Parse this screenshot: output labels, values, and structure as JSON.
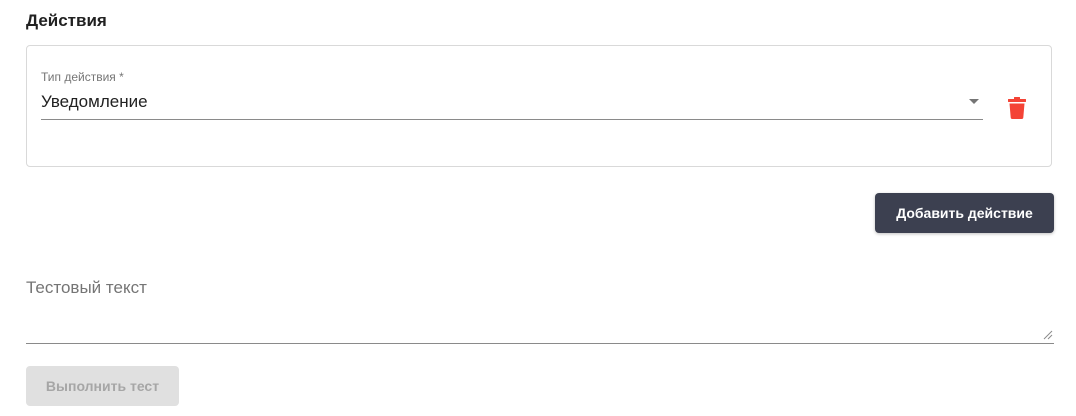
{
  "actions_section": {
    "title": "Действия",
    "items": [
      {
        "type_label": "Тип действия *",
        "type_value": "Уведомление",
        "delete_icon": "trash-icon"
      }
    ],
    "add_button_label": "Добавить действие"
  },
  "test": {
    "text_label": "Тестовый текст",
    "text_value": "",
    "run_button_label": "Выполнить тест",
    "run_button_disabled": true
  },
  "colors": {
    "primary_button": "#3c4050",
    "delete_icon": "#f44336",
    "disabled_button_bg": "#e0e0e0",
    "disabled_button_text": "#a6a6a6"
  }
}
